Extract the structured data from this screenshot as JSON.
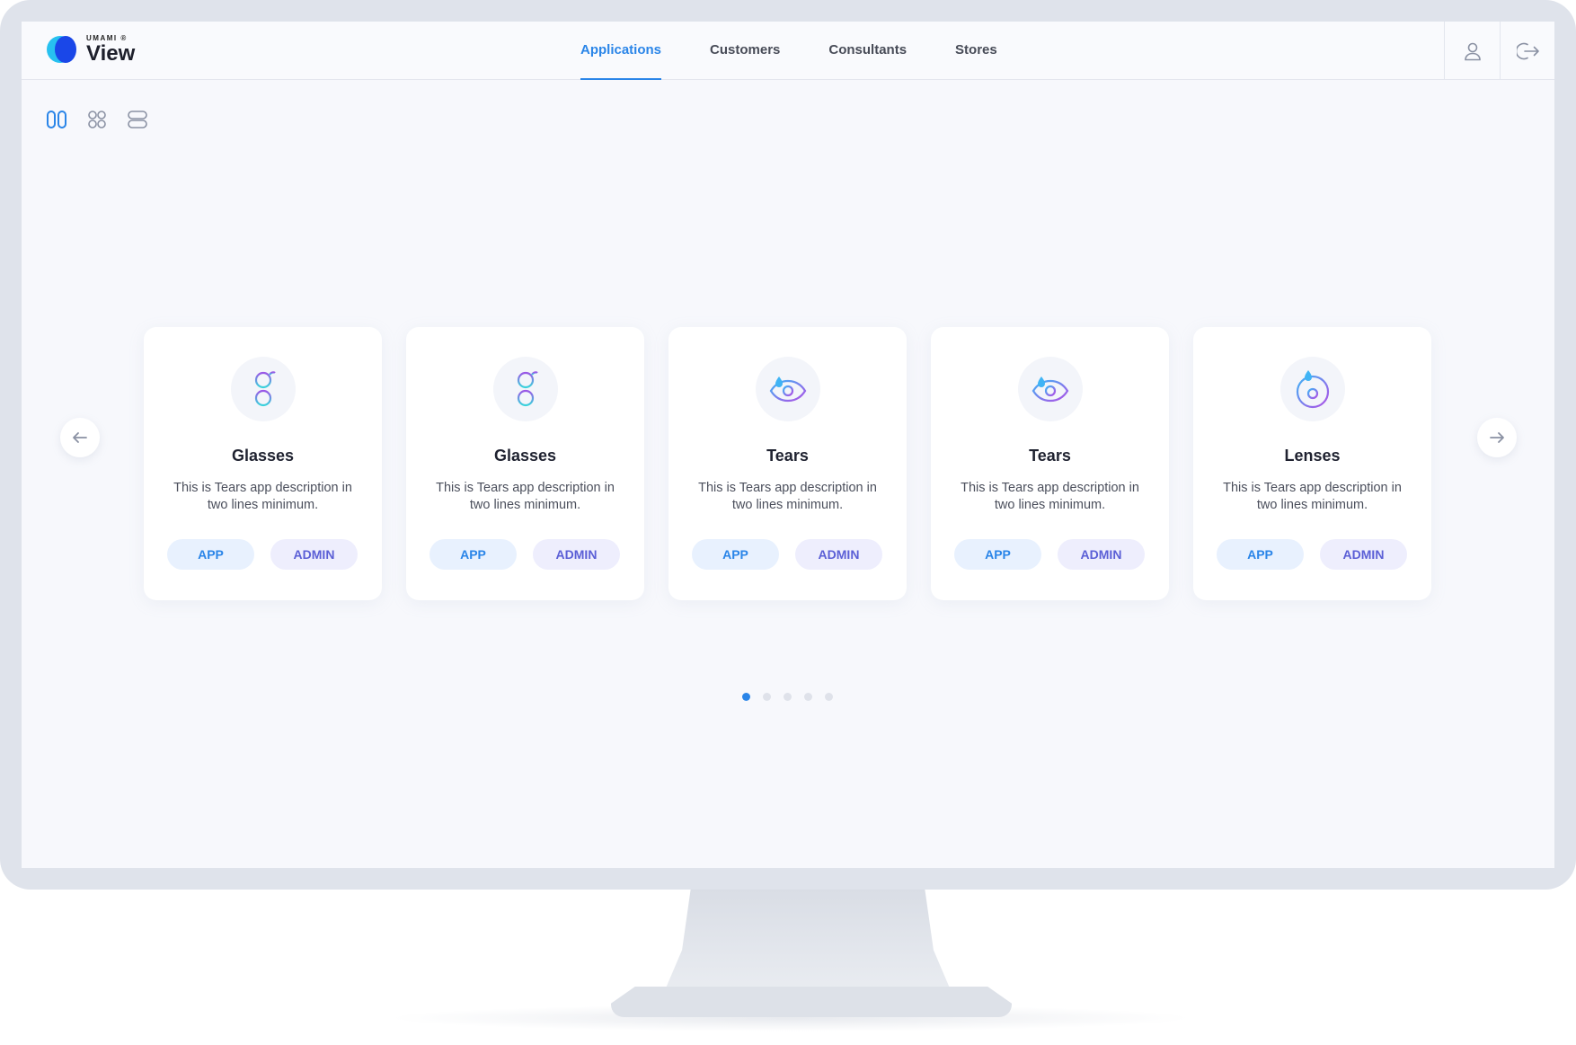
{
  "app": {
    "brand": "UMAMI ®",
    "title": "View",
    "accent": "#2a85e8"
  },
  "nav": {
    "items": [
      {
        "label": "Applications",
        "active": true
      },
      {
        "label": "Customers",
        "active": false
      },
      {
        "label": "Consultants",
        "active": false
      },
      {
        "label": "Stores",
        "active": false
      }
    ]
  },
  "header_actions": {
    "profile_icon": "user-icon",
    "logout_icon": "logout-icon"
  },
  "view_toggles": [
    {
      "icon": "columns-view-icon",
      "active": true
    },
    {
      "icon": "grid-view-icon",
      "active": false
    },
    {
      "icon": "list-view-icon",
      "active": false
    }
  ],
  "carousel": {
    "prev_icon": "arrow-left-icon",
    "next_icon": "arrow-right-icon",
    "cards": [
      {
        "title": "Glasses",
        "icon": "glasses-icon",
        "description": "This is Tears app description in two lines minimum.",
        "app_label": "APP",
        "admin_label": "ADMIN"
      },
      {
        "title": "Glasses",
        "icon": "glasses-icon",
        "description": "This is Tears app description in two lines minimum.",
        "app_label": "APP",
        "admin_label": "ADMIN"
      },
      {
        "title": "Tears",
        "icon": "eye-tear-icon",
        "description": "This is Tears app description in two lines minimum.",
        "app_label": "APP",
        "admin_label": "ADMIN"
      },
      {
        "title": "Tears",
        "icon": "eye-tear-icon",
        "description": "This is Tears app description in two lines minimum.",
        "app_label": "APP",
        "admin_label": "ADMIN"
      },
      {
        "title": "Lenses",
        "icon": "lens-icon",
        "description": "This is Tears app description in two lines minimum.",
        "app_label": "APP",
        "admin_label": "ADMIN"
      }
    ],
    "pages": 5,
    "current_page": 1
  }
}
